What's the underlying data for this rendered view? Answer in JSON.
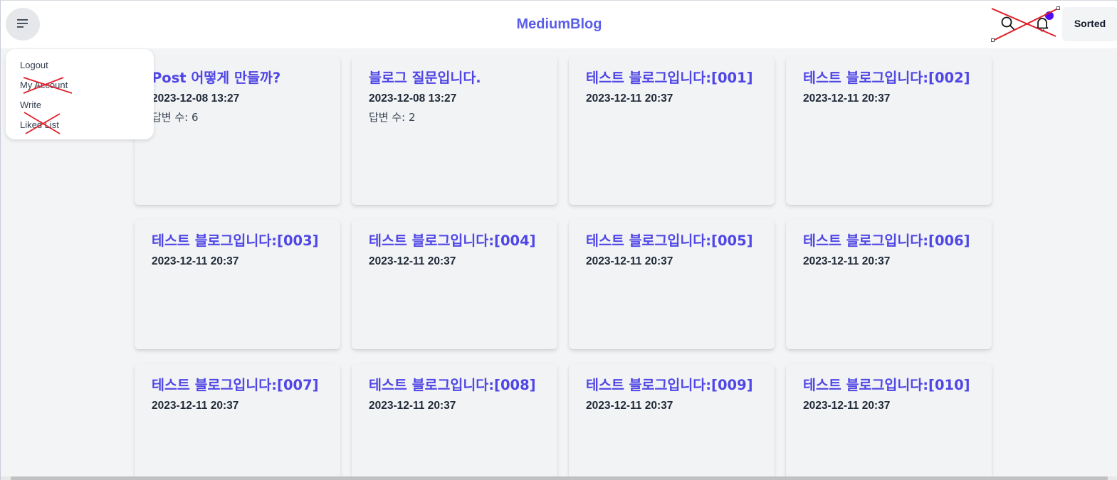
{
  "header": {
    "title": "MediumBlog",
    "sorted_label": "Sorted",
    "menu_icon": "hamburger-menu-icon",
    "search_icon": "search-icon",
    "bell_icon": "bell-icon"
  },
  "menu": {
    "items": [
      {
        "label": "Logout",
        "crossed": false
      },
      {
        "label": "My Account",
        "crossed": true
      },
      {
        "label": "Write",
        "crossed": false
      },
      {
        "label": "Liked List",
        "crossed": true
      }
    ]
  },
  "posts": [
    {
      "title": "Post 어떻게 만들까?",
      "date": "2023-12-08 13:27",
      "answers": "답변 수: 6"
    },
    {
      "title": "블로그 질문입니다.",
      "date": "2023-12-08 13:27",
      "answers": "답변 수: 2"
    },
    {
      "title": "테스트 블로그입니다:[001]",
      "date": "2023-12-11 20:37"
    },
    {
      "title": "테스트 블로그입니다:[002]",
      "date": "2023-12-11 20:37"
    },
    {
      "title": "테스트 블로그입니다:[003]",
      "date": "2023-12-11 20:37"
    },
    {
      "title": "테스트 블로그입니다:[004]",
      "date": "2023-12-11 20:37"
    },
    {
      "title": "테스트 블로그입니다:[005]",
      "date": "2023-12-11 20:37"
    },
    {
      "title": "테스트 블로그입니다:[006]",
      "date": "2023-12-11 20:37"
    },
    {
      "title": "테스트 블로그입니다:[007]",
      "date": "2023-12-11 20:37"
    },
    {
      "title": "테스트 블로그입니다:[008]",
      "date": "2023-12-11 20:37"
    },
    {
      "title": "테스트 블로그입니다:[009]",
      "date": "2023-12-11 20:37"
    },
    {
      "title": "테스트 블로그입니다:[010]",
      "date": "2023-12-11 20:37"
    }
  ],
  "colors": {
    "brand": "#5a5ee8",
    "card_title": "#4f46e5",
    "notification_dot": "#4f0df2",
    "annotation_cross": "#e0202a"
  }
}
